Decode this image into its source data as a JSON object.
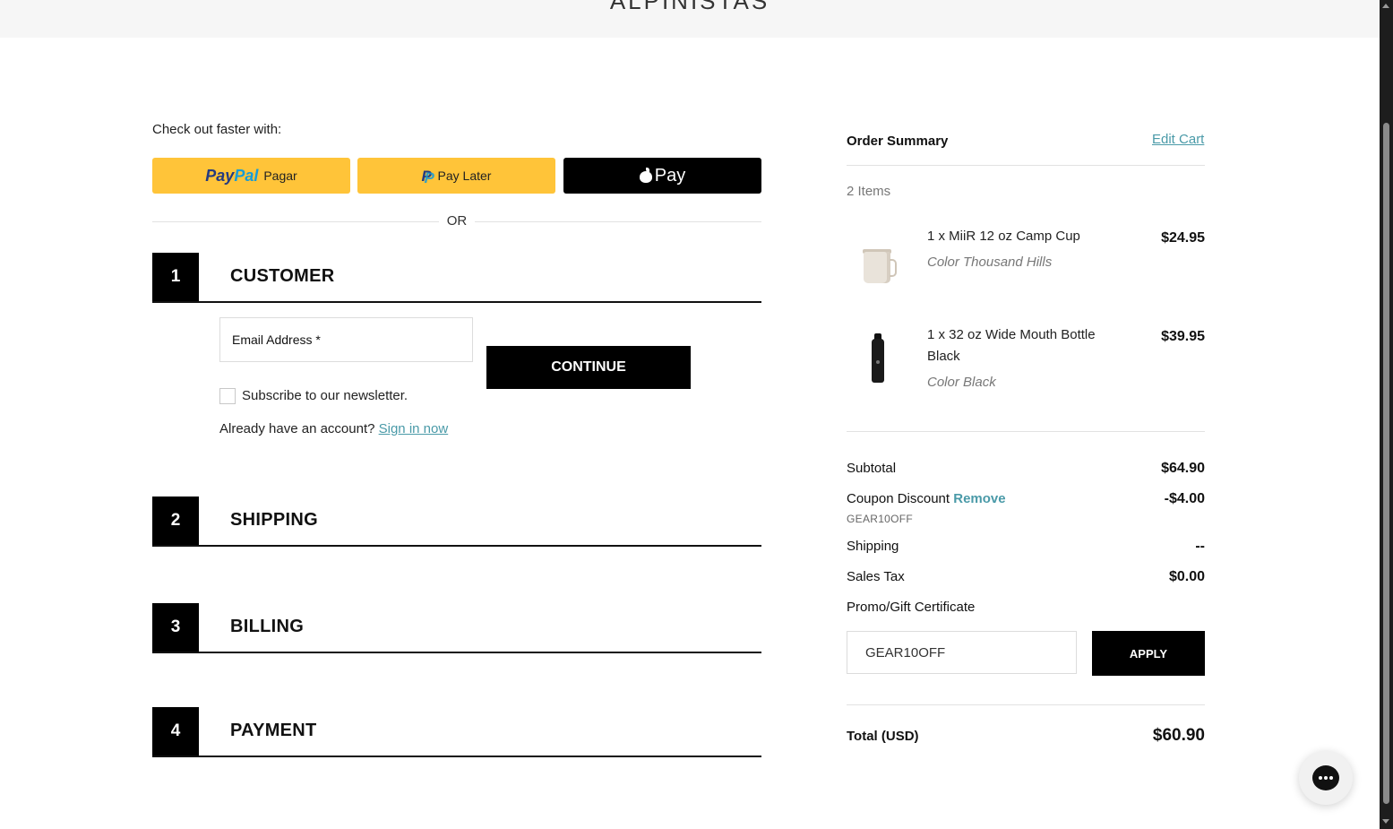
{
  "header": {
    "logo": "ALPINISTAS"
  },
  "express": {
    "label": "Check out faster with:",
    "paypal": {
      "brand_a": "Pay",
      "brand_b": "Pal",
      "sub": "Pagar"
    },
    "paylater": {
      "label": "Pay Later"
    },
    "applepay": {
      "label": "Pay"
    },
    "or_text": "OR"
  },
  "steps": [
    {
      "number": "1",
      "title": "CUSTOMER"
    },
    {
      "number": "2",
      "title": "SHIPPING"
    },
    {
      "number": "3",
      "title": "BILLING"
    },
    {
      "number": "4",
      "title": "PAYMENT"
    }
  ],
  "customer": {
    "email_label": "Email Address *",
    "continue_label": "CONTINUE",
    "newsletter_label": "Subscribe to our newsletter.",
    "account_prompt": "Already have an account?",
    "signin_label": "Sign in now"
  },
  "summary": {
    "title": "Order Summary",
    "edit_cart": "Edit Cart",
    "items_count": "2 Items",
    "items": [
      {
        "name": "1 x MiiR 12 oz Camp Cup",
        "color": "Color Thousand Hills",
        "price": "$24.95"
      },
      {
        "name": "1 x 32 oz Wide Mouth Bottle Black",
        "color": "Color Black",
        "price": "$39.95"
      }
    ],
    "subtotal_label": "Subtotal",
    "subtotal_value": "$64.90",
    "coupon_label": "Coupon Discount",
    "coupon_remove": "Remove",
    "coupon_code": "GEAR10OFF",
    "coupon_value": "-$4.00",
    "shipping_label": "Shipping",
    "shipping_value": "--",
    "tax_label": "Sales Tax",
    "tax_value": "$0.00",
    "promo_label": "Promo/Gift Certificate",
    "promo_value": "GEAR10OFF",
    "apply_label": "APPLY",
    "total_label": "Total (USD)",
    "total_value": "$60.90"
  },
  "icons": {
    "chat": "chat-bubble-icon",
    "apple": "apple-icon",
    "paypal": "paypal-icon"
  },
  "colors": {
    "paypal_yellow": "#ffc439",
    "link": "#4a9aa8",
    "primary": "#000000"
  }
}
